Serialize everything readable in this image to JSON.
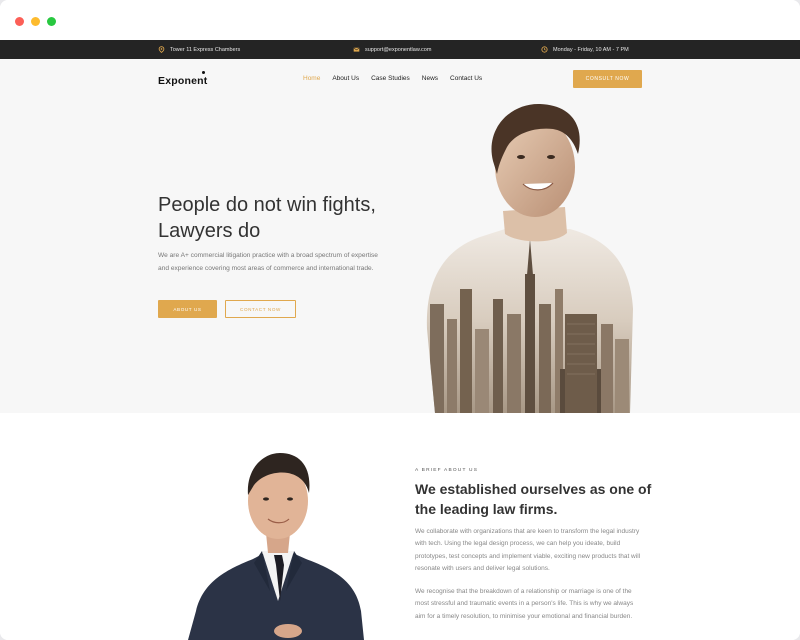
{
  "window": {
    "controls": [
      "close",
      "minimize",
      "maximize"
    ]
  },
  "topbar": {
    "location": "Tower 11 Express Chambers",
    "email": "support@exponentlaw.com",
    "hours": "Monday - Friday, 10 AM - 7 PM",
    "icons": [
      "map-pin-icon",
      "mail-icon",
      "clock-icon"
    ]
  },
  "nav": {
    "logo": "Exponent",
    "links": [
      "Home",
      "About Us",
      "Case Studies",
      "News",
      "Contact Us"
    ],
    "active": "Home",
    "cta": "CONSULT NOW"
  },
  "hero": {
    "title_line1": "People do not win fights,",
    "title_line2": "Lawyers do",
    "text": "We are A+ commercial litigation practice with a broad spectrum of expertise and experience covering most areas of commerce and international trade.",
    "btn_about": "ABOUT US",
    "btn_contact": "CONTACT NOW"
  },
  "about": {
    "eyebrow": "A BRIEF ABOUT US",
    "title": "We established ourselves as one of the leading law firms.",
    "p1": "We collaborate with organizations that are keen to transform the legal industry with tech. Using the legal design process, we can help you ideate, build prototypes, test concepts and implement viable, exciting new products that will resonate with users and deliver legal solutions.",
    "p2": "We recognise that the breakdown of a relationship or marriage is one of the most stressful and traumatic events in a person's life. This is why we always aim for a timely resolution, to minimise your emotional and financial burden."
  },
  "colors": {
    "accent": "#e0a84e",
    "topbar": "#242424",
    "hero_bg": "#f7f7f7"
  }
}
